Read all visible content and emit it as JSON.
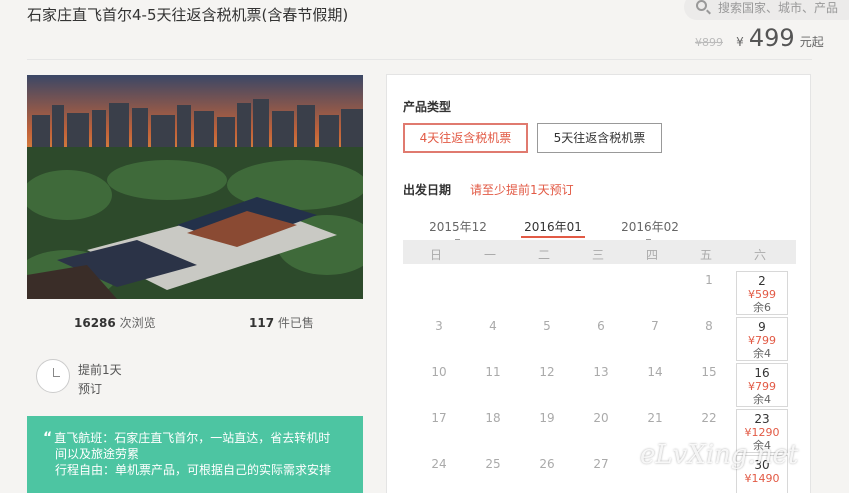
{
  "header": {
    "title": "石家庄直飞首尔4-5天往返含税机票(含春节假期)",
    "search_placeholder": "搜索国家、城市、产品",
    "old_price": "¥899",
    "currency_symbol": "¥",
    "price": "499",
    "price_suffix": "元起"
  },
  "left": {
    "views_count": "16286",
    "views_label": "次浏览",
    "sold_count": "117",
    "sold_label": "件已售",
    "advance_line1": "提前1天",
    "advance_line2": "预订",
    "info_line1": "直飞航班：石家庄直飞首尔，一站直达，省去转机时",
    "info_line1b": "间以及旅途劳累",
    "info_line2": "行程自由：单机票产品，可根据自己的实际需求安排"
  },
  "panel": {
    "product_type_label": "产品类型",
    "product_types": [
      "4天往返含税机票",
      "5天往返含税机票"
    ],
    "departure_label": "出发日期",
    "advance_hint": "请至少提前1天预订",
    "months": [
      "2015年12",
      "2016年01",
      "2016年02"
    ],
    "weekdays": [
      "日",
      "一",
      "二",
      "三",
      "四",
      "五",
      "六"
    ],
    "plain_days": [
      "1",
      "3",
      "4",
      "5",
      "6",
      "7",
      "8",
      "10",
      "11",
      "12",
      "13",
      "14",
      "15",
      "17",
      "18",
      "19",
      "20",
      "21",
      "22",
      "24",
      "25",
      "26",
      "27"
    ],
    "priced_days": [
      {
        "day": "2",
        "price": "¥599",
        "remain": "余6"
      },
      {
        "day": "9",
        "price": "¥799",
        "remain": "余4"
      },
      {
        "day": "16",
        "price": "¥799",
        "remain": "余4"
      },
      {
        "day": "23",
        "price": "¥1290",
        "remain": "余4"
      },
      {
        "day": "30",
        "price": "¥1490",
        "remain": ""
      }
    ]
  },
  "watermark": "eLvXing.net"
}
